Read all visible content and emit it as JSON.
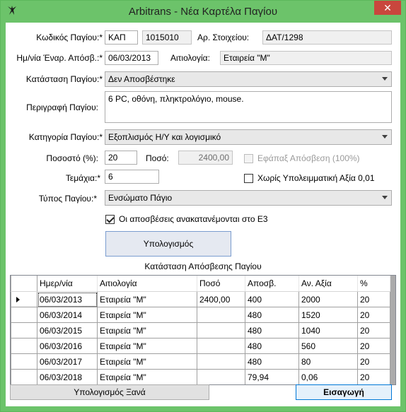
{
  "window": {
    "title": "Arbitrans - Νέα Καρτέλα Παγίου",
    "close_glyph": "✕"
  },
  "form": {
    "asset_code_label": "Κωδικός Παγίου:*",
    "asset_code_prefix": "ΚΑΠ",
    "asset_code_number": "1015010",
    "element_no_label": "Αρ. Στοιχείου:",
    "element_no_value": "ΔΑΤ/1298",
    "start_date_label": "Ημ/νία Έναρ. Απόσβ.:*",
    "start_date_value": "06/03/2013",
    "reason_label": "Αιτιολογία:",
    "reason_value": "Εταιρεία \"Μ\"",
    "status_label": "Κατάσταση Παγίου:*",
    "status_value": "Δεν Αποσβέστηκε",
    "description_label": "Περιγραφή Παγίου:",
    "description_value": "6 PC, οθόνη, πληκτρολόγιο, mouse.",
    "category_label": "Κατηγορία Παγίου:*",
    "category_value": "Εξοπλισμός Η/Υ και λογισμικό",
    "percent_label": "Ποσοστό (%):",
    "percent_value": "20",
    "amount_label": "Ποσό:",
    "amount_value": "2400,00",
    "one_time_label": "Εφάπαξ Απόσβεση (100%)",
    "quantity_label": "Τεμάχια:*",
    "quantity_value": "6",
    "no_residual_label": "Χωρίς Υπολειμματική Αξία 0,01",
    "type_label": "Τύπος Παγίου:*",
    "type_value": "Ενσώματο Πάγιο",
    "redistribute_label": "Οι αποσβέσεις ανακατανέμονται στο Ε3",
    "calculate_button": "Υπολογισμός"
  },
  "schedule": {
    "title": "Κατάσταση Απόσβεσης Παγίου",
    "columns": [
      "Ημερ/νία",
      "Αιτιολογία",
      "Ποσό",
      "Αποσβ.",
      "Αν. Αξία",
      "%"
    ],
    "rows": [
      [
        "06/03/2013",
        "Εταιρεία \"Μ\"",
        "2400,00",
        "400",
        "2000",
        "20"
      ],
      [
        "06/03/2014",
        "Εταιρεία \"Μ\"",
        "",
        "480",
        "1520",
        "20"
      ],
      [
        "06/03/2015",
        "Εταιρεία \"Μ\"",
        "",
        "480",
        "1040",
        "20"
      ],
      [
        "06/03/2016",
        "Εταιρεία \"Μ\"",
        "",
        "480",
        "560",
        "20"
      ],
      [
        "06/03/2017",
        "Εταιρεία \"Μ\"",
        "",
        "480",
        "80",
        "20"
      ],
      [
        "06/03/2018",
        "Εταιρεία \"Μ\"",
        "",
        "79,94",
        "0,06",
        "20"
      ]
    ]
  },
  "footer": {
    "recalculate_button": "Υπολογισμός Ξανά",
    "insert_button": "Εισαγωγή"
  }
}
